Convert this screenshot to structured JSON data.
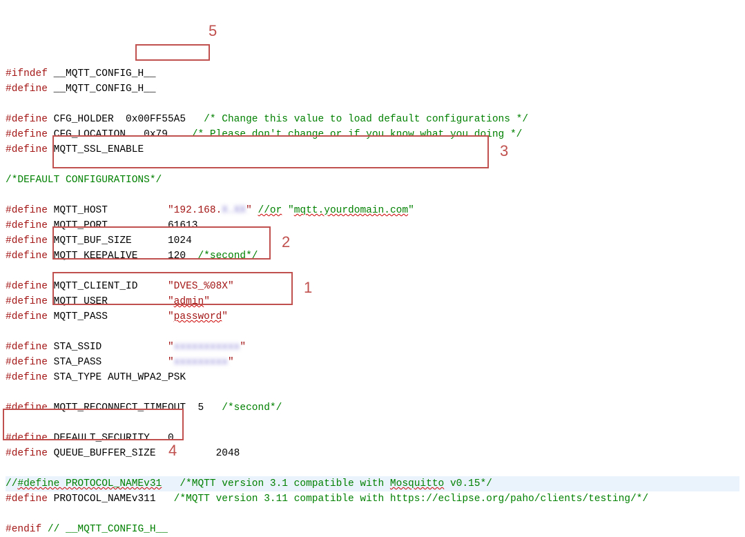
{
  "tokens": {
    "ifndef": "#ifndef",
    "define": "#define",
    "endif": "#endif",
    "guard": "__MQTT_CONFIG_H__",
    "guard_cm": "// __MQTT_CONFIG_H__"
  },
  "l_cfg_holder_name": "CFG_HOLDER",
  "l_cfg_holder_val": "0x00FF55A5",
  "l_cfg_holder_cm": "/* Change this value to load default configurations */",
  "l_cfg_loc_name": "CFG_LOCATION",
  "l_cfg_loc_val": "0x79",
  "l_cfg_loc_cm": "/* Please don't change or if you know what you doing */",
  "l_ssl": "MQTT_SSL_ENABLE",
  "l_defcfg": "/*DEFAULT CONFIGURATIONS*/",
  "l_host_name": "MQTT_HOST",
  "l_host_val": "\"192.168.    \"",
  "l_host_cm": "//or \"mqtt.yourdomain.com\"",
  "l_port_name": "MQTT_PORT",
  "l_port_val": "61613",
  "l_buf_name": "MQTT_BUF_SIZE",
  "l_buf_val": "1024",
  "l_ka_name": "MQTT_KEEPALIVE",
  "l_ka_val": "120",
  "l_ka_cm": "/*second*/",
  "l_cid_name": "MQTT_CLIENT_ID",
  "l_cid_val": "\"DVES_%08X\"",
  "l_user_name": "MQTT_USER",
  "l_user_val": "\"admin\"",
  "l_pass_name": "MQTT_PASS",
  "l_pass_val": "\"password\"",
  "l_ssid_name": "STA_SSID",
  "l_ssid_val": "\"          \"",
  "l_spass_name": "STA_PASS",
  "l_spass_val": "\"        \"",
  "l_stype": "STA_TYPE AUTH_WPA2_PSK",
  "l_reco_name": "MQTT_RECONNECT_TIMEOUT",
  "l_reco_val": "5",
  "l_reco_cm": "/*second*/",
  "l_sec_name": "DEFAULT_SECURITY",
  "l_sec_val": "0",
  "l_qbs_name": "QUEUE_BUFFER_SIZE",
  "l_qbs_val": "2048",
  "l_p31_a": "//",
  "l_p31_b": "#define PROTOCOL_NAMEv31",
  "l_p31_cm": "/*MQTT version 3.1 compatible with Mosquitto v0.15*/",
  "l_p311_name": "PROTOCOL_NAMEv311",
  "l_p311_cm": "/*MQTT version 3.11 compatible with https://eclipse.org/paho/clients/testing/*/",
  "ann": {
    "a1": "1",
    "a2": "2",
    "a3": "3",
    "a4": "4",
    "a5": "5"
  }
}
